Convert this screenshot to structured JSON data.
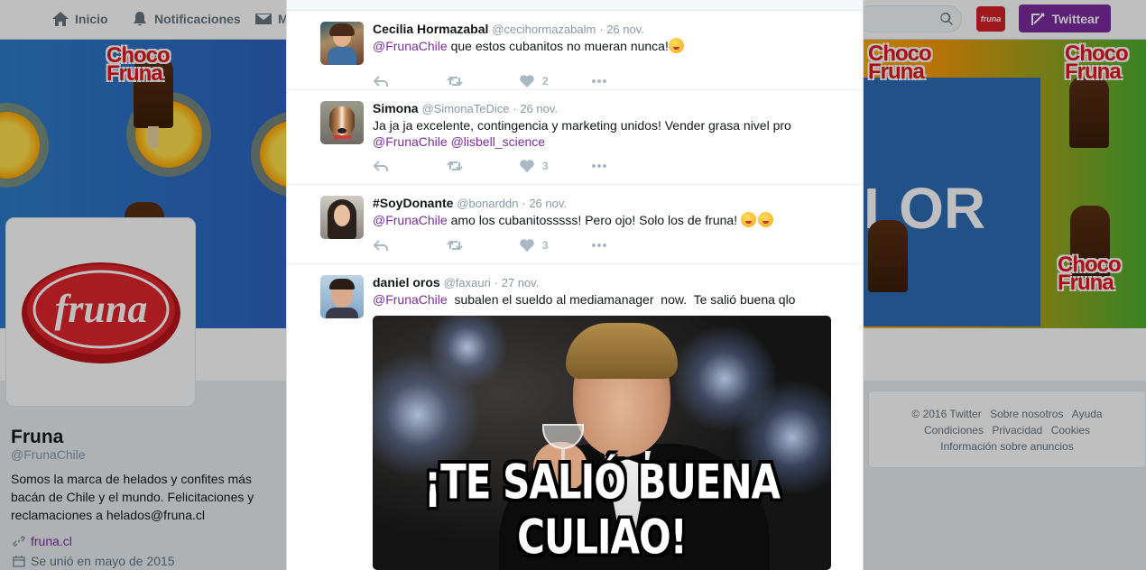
{
  "nav": {
    "home_label": "Inicio",
    "notifications_label": "Notificaciones",
    "messages_label": "M",
    "tweet_button_label": "Twittear",
    "account_logo_text": "fruna"
  },
  "banner": {
    "brand_logo_lines": [
      "Choco",
      "Fruna"
    ],
    "panel_text": "LOR"
  },
  "profile": {
    "logo_text": "fruna",
    "name": "Fruna",
    "handle": "@FrunaChile",
    "bio": "Somos la marca de helados y confites más bacán de Chile y el mundo. Felicitaciones y reclamaciones a helados@fruna.cl",
    "website": "fruna.cl",
    "joined": "Se unió en mayo de 2015"
  },
  "footer": {
    "line1": [
      "© 2016 Twitter",
      "Sobre nosotros",
      "Ayuda"
    ],
    "line2": [
      "Condiciones",
      "Privacidad",
      "Cookies"
    ],
    "line3": "Información sobre anuncios"
  },
  "tweets": [
    {
      "name": "Cecilia Hormazabal",
      "handle": "@cecihormazabalm",
      "date": "· 26 nov.",
      "mention": "@FrunaChile",
      "text": " que estos cubanitos no mueran nunca!",
      "likes": "2"
    },
    {
      "name": "Simona",
      "handle": "@SimonaTeDice",
      "date": "· 26 nov.",
      "text": "Ja ja ja excelente, contingencia y marketing unidos! Vender grasa nivel pro",
      "mention": "@FrunaChile",
      "mention2": "@lisbell_science",
      "likes": "3"
    },
    {
      "name": "#SoyDonante",
      "handle": "@bonarddn",
      "date": "· 26 nov.",
      "mention": "@FrunaChile",
      "text": " amo los cubanitosssss! Pero ojo! Solo los de fruna! ",
      "likes": "3"
    },
    {
      "name": "daniel oros",
      "handle": "@faxauri",
      "date": "· 27 nov.",
      "mention": "@FrunaChile",
      "text": "  subalen el sueldo al mediamanager  now.  Te salió buena qlo",
      "meme_caption": "¡TE SALIÓ BUENA CULIAO!"
    }
  ],
  "colors": {
    "brand_purple": "#7b2d9e",
    "fruna_red": "#d32027"
  }
}
